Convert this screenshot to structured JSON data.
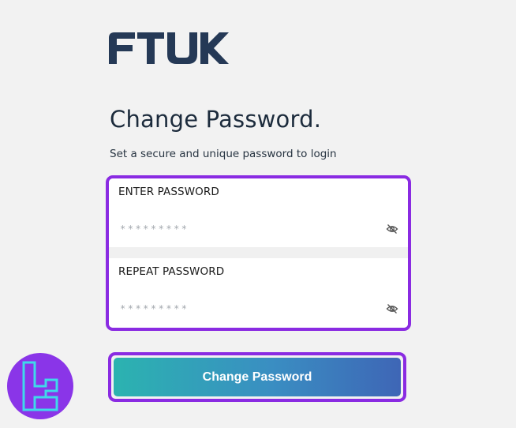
{
  "brand": {
    "logo_text": "FTUK",
    "logo_color": "#253956"
  },
  "page": {
    "title": "Change Password.",
    "subtitle": "Set a secure and unique password to login"
  },
  "form": {
    "password": {
      "label": "ENTER PASSWORD",
      "placeholder": "*********",
      "value": "",
      "toggle_icon": "eye-slash-icon"
    },
    "repeat_password": {
      "label": "REPEAT PASSWORD",
      "placeholder": "*********",
      "value": "",
      "toggle_icon": "eye-slash-icon"
    },
    "submit_label": "Change Password"
  },
  "colors": {
    "highlight": "#8a2be2",
    "button_gradient_start": "#2bb3b0",
    "button_gradient_end": "#3e66b6",
    "background": "#f2f2f2"
  },
  "watermark": {
    "icon": "tradingfinder-logo-icon",
    "background": "#8a35e8"
  }
}
